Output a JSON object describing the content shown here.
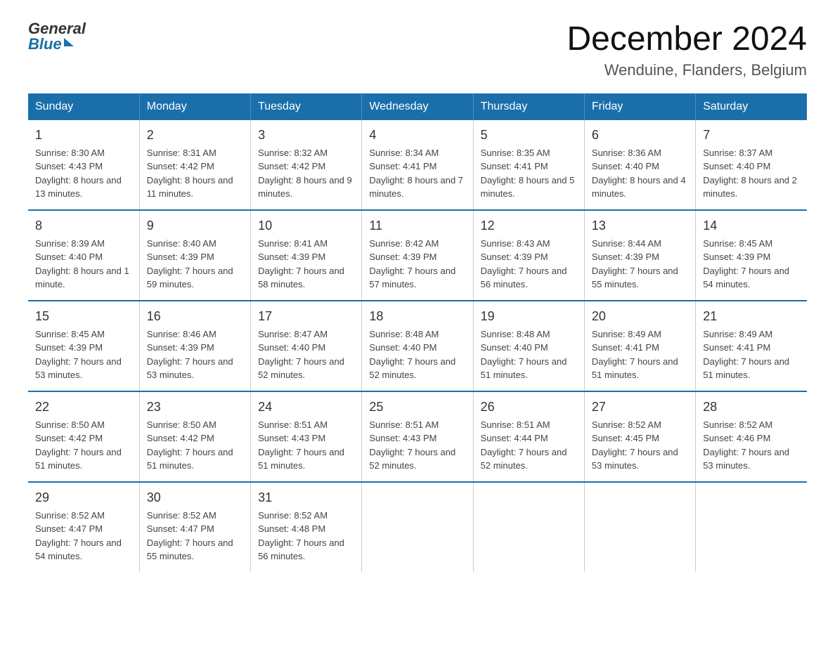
{
  "header": {
    "logo_general": "General",
    "logo_blue": "Blue",
    "month_title": "December 2024",
    "location": "Wenduine, Flanders, Belgium"
  },
  "days_of_week": [
    "Sunday",
    "Monday",
    "Tuesday",
    "Wednesday",
    "Thursday",
    "Friday",
    "Saturday"
  ],
  "weeks": [
    [
      {
        "day": "1",
        "sunrise": "Sunrise: 8:30 AM",
        "sunset": "Sunset: 4:43 PM",
        "daylight": "Daylight: 8 hours and 13 minutes."
      },
      {
        "day": "2",
        "sunrise": "Sunrise: 8:31 AM",
        "sunset": "Sunset: 4:42 PM",
        "daylight": "Daylight: 8 hours and 11 minutes."
      },
      {
        "day": "3",
        "sunrise": "Sunrise: 8:32 AM",
        "sunset": "Sunset: 4:42 PM",
        "daylight": "Daylight: 8 hours and 9 minutes."
      },
      {
        "day": "4",
        "sunrise": "Sunrise: 8:34 AM",
        "sunset": "Sunset: 4:41 PM",
        "daylight": "Daylight: 8 hours and 7 minutes."
      },
      {
        "day": "5",
        "sunrise": "Sunrise: 8:35 AM",
        "sunset": "Sunset: 4:41 PM",
        "daylight": "Daylight: 8 hours and 5 minutes."
      },
      {
        "day": "6",
        "sunrise": "Sunrise: 8:36 AM",
        "sunset": "Sunset: 4:40 PM",
        "daylight": "Daylight: 8 hours and 4 minutes."
      },
      {
        "day": "7",
        "sunrise": "Sunrise: 8:37 AM",
        "sunset": "Sunset: 4:40 PM",
        "daylight": "Daylight: 8 hours and 2 minutes."
      }
    ],
    [
      {
        "day": "8",
        "sunrise": "Sunrise: 8:39 AM",
        "sunset": "Sunset: 4:40 PM",
        "daylight": "Daylight: 8 hours and 1 minute."
      },
      {
        "day": "9",
        "sunrise": "Sunrise: 8:40 AM",
        "sunset": "Sunset: 4:39 PM",
        "daylight": "Daylight: 7 hours and 59 minutes."
      },
      {
        "day": "10",
        "sunrise": "Sunrise: 8:41 AM",
        "sunset": "Sunset: 4:39 PM",
        "daylight": "Daylight: 7 hours and 58 minutes."
      },
      {
        "day": "11",
        "sunrise": "Sunrise: 8:42 AM",
        "sunset": "Sunset: 4:39 PM",
        "daylight": "Daylight: 7 hours and 57 minutes."
      },
      {
        "day": "12",
        "sunrise": "Sunrise: 8:43 AM",
        "sunset": "Sunset: 4:39 PM",
        "daylight": "Daylight: 7 hours and 56 minutes."
      },
      {
        "day": "13",
        "sunrise": "Sunrise: 8:44 AM",
        "sunset": "Sunset: 4:39 PM",
        "daylight": "Daylight: 7 hours and 55 minutes."
      },
      {
        "day": "14",
        "sunrise": "Sunrise: 8:45 AM",
        "sunset": "Sunset: 4:39 PM",
        "daylight": "Daylight: 7 hours and 54 minutes."
      }
    ],
    [
      {
        "day": "15",
        "sunrise": "Sunrise: 8:45 AM",
        "sunset": "Sunset: 4:39 PM",
        "daylight": "Daylight: 7 hours and 53 minutes."
      },
      {
        "day": "16",
        "sunrise": "Sunrise: 8:46 AM",
        "sunset": "Sunset: 4:39 PM",
        "daylight": "Daylight: 7 hours and 53 minutes."
      },
      {
        "day": "17",
        "sunrise": "Sunrise: 8:47 AM",
        "sunset": "Sunset: 4:40 PM",
        "daylight": "Daylight: 7 hours and 52 minutes."
      },
      {
        "day": "18",
        "sunrise": "Sunrise: 8:48 AM",
        "sunset": "Sunset: 4:40 PM",
        "daylight": "Daylight: 7 hours and 52 minutes."
      },
      {
        "day": "19",
        "sunrise": "Sunrise: 8:48 AM",
        "sunset": "Sunset: 4:40 PM",
        "daylight": "Daylight: 7 hours and 51 minutes."
      },
      {
        "day": "20",
        "sunrise": "Sunrise: 8:49 AM",
        "sunset": "Sunset: 4:41 PM",
        "daylight": "Daylight: 7 hours and 51 minutes."
      },
      {
        "day": "21",
        "sunrise": "Sunrise: 8:49 AM",
        "sunset": "Sunset: 4:41 PM",
        "daylight": "Daylight: 7 hours and 51 minutes."
      }
    ],
    [
      {
        "day": "22",
        "sunrise": "Sunrise: 8:50 AM",
        "sunset": "Sunset: 4:42 PM",
        "daylight": "Daylight: 7 hours and 51 minutes."
      },
      {
        "day": "23",
        "sunrise": "Sunrise: 8:50 AM",
        "sunset": "Sunset: 4:42 PM",
        "daylight": "Daylight: 7 hours and 51 minutes."
      },
      {
        "day": "24",
        "sunrise": "Sunrise: 8:51 AM",
        "sunset": "Sunset: 4:43 PM",
        "daylight": "Daylight: 7 hours and 51 minutes."
      },
      {
        "day": "25",
        "sunrise": "Sunrise: 8:51 AM",
        "sunset": "Sunset: 4:43 PM",
        "daylight": "Daylight: 7 hours and 52 minutes."
      },
      {
        "day": "26",
        "sunrise": "Sunrise: 8:51 AM",
        "sunset": "Sunset: 4:44 PM",
        "daylight": "Daylight: 7 hours and 52 minutes."
      },
      {
        "day": "27",
        "sunrise": "Sunrise: 8:52 AM",
        "sunset": "Sunset: 4:45 PM",
        "daylight": "Daylight: 7 hours and 53 minutes."
      },
      {
        "day": "28",
        "sunrise": "Sunrise: 8:52 AM",
        "sunset": "Sunset: 4:46 PM",
        "daylight": "Daylight: 7 hours and 53 minutes."
      }
    ],
    [
      {
        "day": "29",
        "sunrise": "Sunrise: 8:52 AM",
        "sunset": "Sunset: 4:47 PM",
        "daylight": "Daylight: 7 hours and 54 minutes."
      },
      {
        "day": "30",
        "sunrise": "Sunrise: 8:52 AM",
        "sunset": "Sunset: 4:47 PM",
        "daylight": "Daylight: 7 hours and 55 minutes."
      },
      {
        "day": "31",
        "sunrise": "Sunrise: 8:52 AM",
        "sunset": "Sunset: 4:48 PM",
        "daylight": "Daylight: 7 hours and 56 minutes."
      },
      null,
      null,
      null,
      null
    ]
  ]
}
